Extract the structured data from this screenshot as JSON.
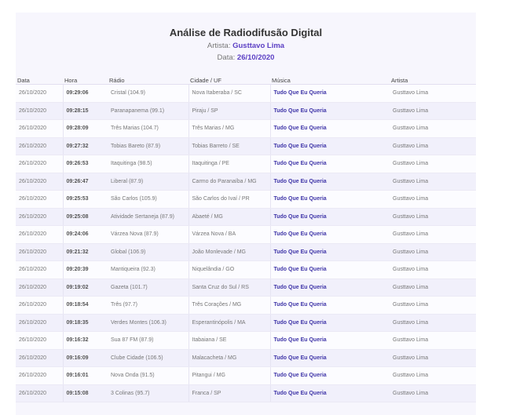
{
  "header": {
    "title": "Análise de Radiodifusão Digital",
    "artist_label": "Artista:",
    "artist_value": "Gusttavo Lima",
    "date_label": "Data:",
    "date_value": "26/10/2020"
  },
  "columns": [
    "Data",
    "Hora",
    "Rádio",
    "Cidade / UF",
    "Música",
    "Artista"
  ],
  "rows": [
    {
      "data": "26/10/2020",
      "hora": "09:29:06",
      "radio": "Cristal (104.9)",
      "cidade": "Nova Itaberaba / SC",
      "musica": "Tudo Que Eu Queria",
      "artista": "Gusttavo Lima"
    },
    {
      "data": "26/10/2020",
      "hora": "09:28:15",
      "radio": "Paranapanema (99.1)",
      "cidade": "Piraju / SP",
      "musica": "Tudo Que Eu Queria",
      "artista": "Gusttavo Lima"
    },
    {
      "data": "26/10/2020",
      "hora": "09:28:09",
      "radio": "Três Marias (104.7)",
      "cidade": "Três Marias / MG",
      "musica": "Tudo Que Eu Queria",
      "artista": "Gusttavo Lima"
    },
    {
      "data": "26/10/2020",
      "hora": "09:27:32",
      "radio": "Tobias Bareto (87.9)",
      "cidade": "Tobias Barreto / SE",
      "musica": "Tudo Que Eu Queria",
      "artista": "Gusttavo Lima"
    },
    {
      "data": "26/10/2020",
      "hora": "09:26:53",
      "radio": "Itaquitinga (98.5)",
      "cidade": "Itaquitinga / PE",
      "musica": "Tudo Que Eu Queria",
      "artista": "Gusttavo Lima"
    },
    {
      "data": "26/10/2020",
      "hora": "09:26:47",
      "radio": "Liberal (87.9)",
      "cidade": "Carmo do Paranaíba / MG",
      "musica": "Tudo Que Eu Queria",
      "artista": "Gusttavo Lima"
    },
    {
      "data": "26/10/2020",
      "hora": "09:25:53",
      "radio": "São Carlos (105.9)",
      "cidade": "São Carlos do Ivaí / PR",
      "musica": "Tudo Que Eu Queria",
      "artista": "Gusttavo Lima"
    },
    {
      "data": "26/10/2020",
      "hora": "09:25:08",
      "radio": "Atividade Sertaneja (87.9)",
      "cidade": "Abaeté / MG",
      "musica": "Tudo Que Eu Queria",
      "artista": "Gusttavo Lima"
    },
    {
      "data": "26/10/2020",
      "hora": "09:24:06",
      "radio": "Várzea Nova (87.9)",
      "cidade": "Várzea Nova / BA",
      "musica": "Tudo Que Eu Queria",
      "artista": "Gusttavo Lima"
    },
    {
      "data": "26/10/2020",
      "hora": "09:21:32",
      "radio": "Global (106.9)",
      "cidade": "João Monlevade / MG",
      "musica": "Tudo Que Eu Queria",
      "artista": "Gusttavo Lima"
    },
    {
      "data": "26/10/2020",
      "hora": "09:20:39",
      "radio": "Mantiqueira (92.3)",
      "cidade": "Niquelândia / GO",
      "musica": "Tudo Que Eu Queria",
      "artista": "Gusttavo Lima"
    },
    {
      "data": "26/10/2020",
      "hora": "09:19:02",
      "radio": "Gazeta (101.7)",
      "cidade": "Santa Cruz do Sul / RS",
      "musica": "Tudo Que Eu Queria",
      "artista": "Gusttavo Lima"
    },
    {
      "data": "26/10/2020",
      "hora": "09:18:54",
      "radio": "Três (97.7)",
      "cidade": "Três Corações / MG",
      "musica": "Tudo Que Eu Queria",
      "artista": "Gusttavo Lima"
    },
    {
      "data": "26/10/2020",
      "hora": "09:18:35",
      "radio": "Verdes Montes (106.3)",
      "cidade": "Esperantinópolis / MA",
      "musica": "Tudo Que Eu Queria",
      "artista": "Gusttavo Lima"
    },
    {
      "data": "26/10/2020",
      "hora": "09:16:32",
      "radio": "Sua 87 FM (87.9)",
      "cidade": "Itabaiana / SE",
      "musica": "Tudo Que Eu Queria",
      "artista": "Gusttavo Lima"
    },
    {
      "data": "26/10/2020",
      "hora": "09:16:09",
      "radio": "Clube Cidade (106.5)",
      "cidade": "Malacacheta / MG",
      "musica": "Tudo Que Eu Queria",
      "artista": "Gusttavo Lima"
    },
    {
      "data": "26/10/2020",
      "hora": "09:16:01",
      "radio": "Nova Onda (91.5)",
      "cidade": "Pitangui / MG",
      "musica": "Tudo Que Eu Queria",
      "artista": "Gusttavo Lima"
    },
    {
      "data": "26/10/2020",
      "hora": "09:15:08",
      "radio": "3 Colinas (95.7)",
      "cidade": "Franca / SP",
      "musica": "Tudo Que Eu Queria",
      "artista": "Gusttavo Lima"
    }
  ],
  "colors": {
    "accent": "#5b3fc4",
    "link": "#3f35a8",
    "background": "#f7f6fd"
  }
}
